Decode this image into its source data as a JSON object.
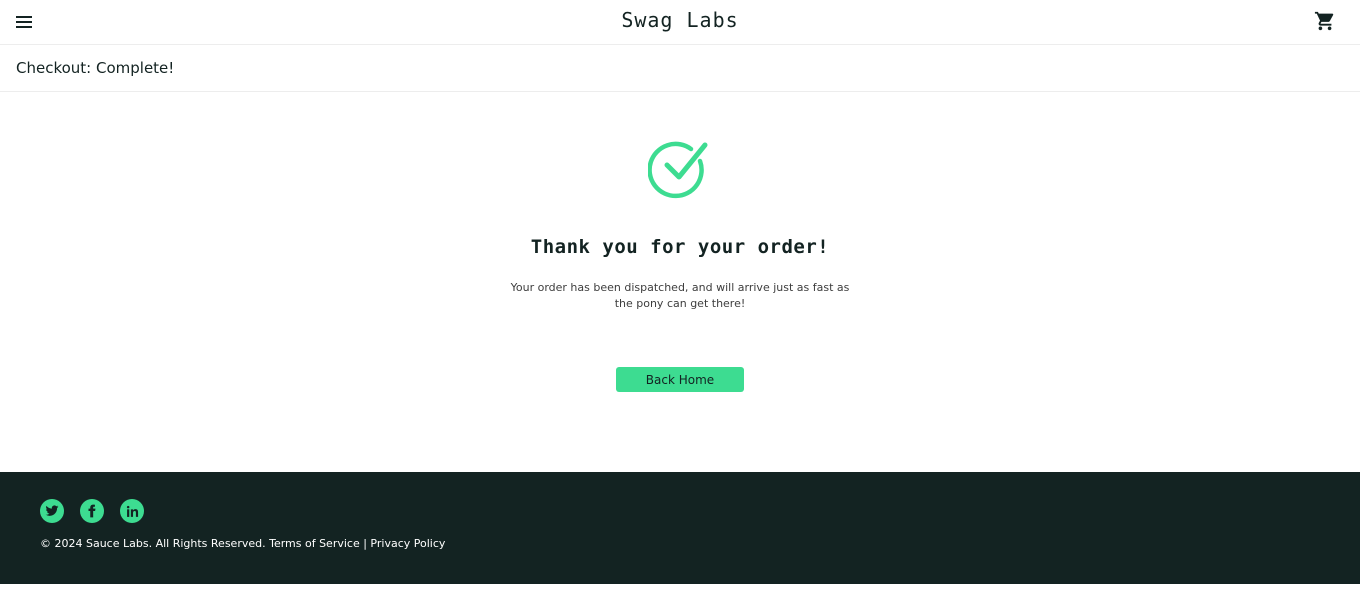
{
  "header": {
    "app_title": "Swag Labs",
    "menu_icon": "hamburger-menu-icon",
    "cart_icon": "shopping-cart-icon"
  },
  "subheader": {
    "title": "Checkout: Complete!"
  },
  "main": {
    "icon": "check-circle-icon",
    "heading": "Thank you for your order!",
    "message": "Your order has been dispatched, and will arrive just as fast as the pony can get there!",
    "back_home_label": "Back Home"
  },
  "footer": {
    "social": [
      "twitter-icon",
      "facebook-icon",
      "linkedin-icon"
    ],
    "copyright": "© 2024 Sauce Labs. All Rights Reserved. Terms of Service | Privacy Policy"
  },
  "colors": {
    "accent": "#3ddc91",
    "text": "#132322",
    "footer_bg": "#132322",
    "border": "#ededed"
  }
}
